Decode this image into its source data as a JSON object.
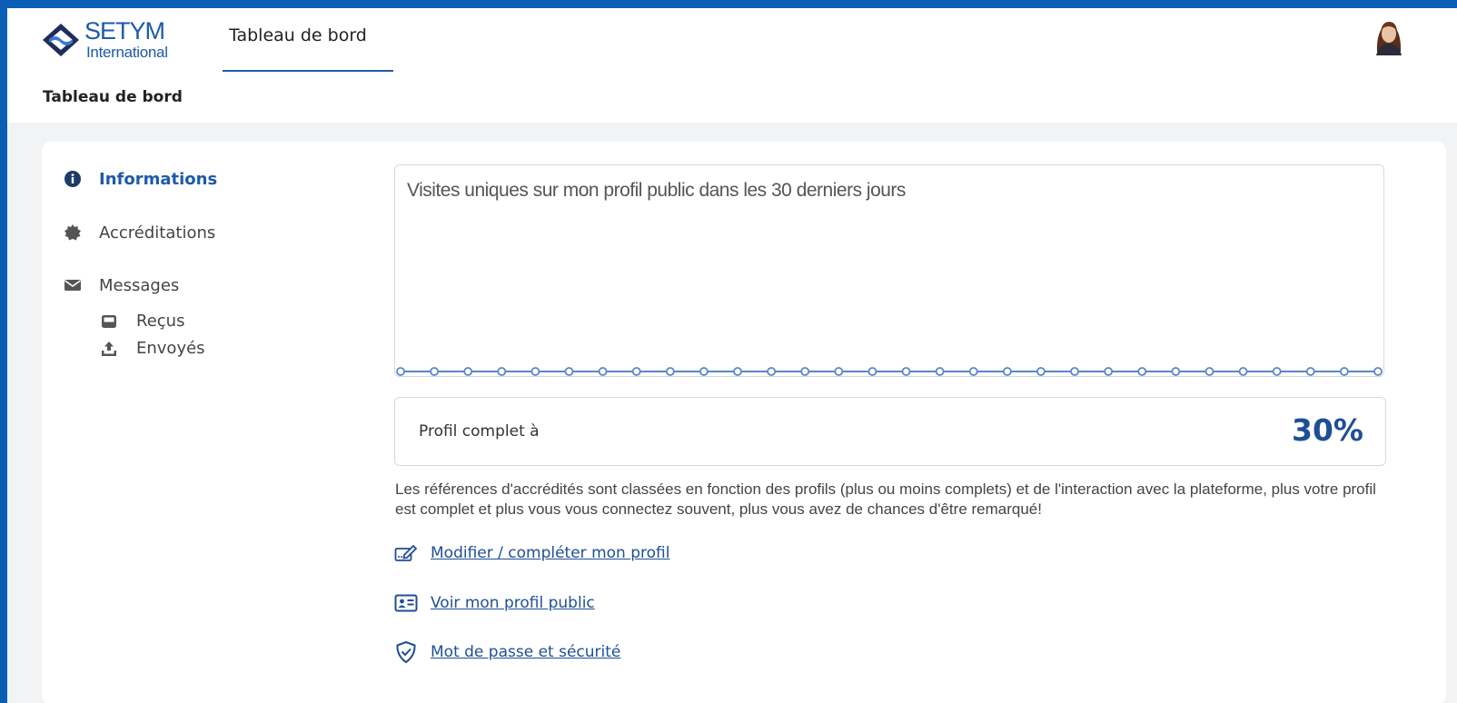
{
  "header": {
    "logo": {
      "brand": "SETYM",
      "sub": "International"
    },
    "tab_label": "Tableau de bord"
  },
  "breadcrumb": "Tableau de bord",
  "sidebar": {
    "items": [
      {
        "label": "Informations",
        "icon": "info-circle-icon",
        "active": true
      },
      {
        "label": "Accréditations",
        "icon": "certificate-badge-icon",
        "active": false
      },
      {
        "label": "Messages",
        "icon": "envelope-icon",
        "active": false
      }
    ],
    "subitems": [
      {
        "label": "Reçus",
        "icon": "inbox-icon"
      },
      {
        "label": "Envoyés",
        "icon": "upload-icon"
      }
    ]
  },
  "chart": {
    "title": "Visites uniques sur mon profil public dans les 30 derniers jours"
  },
  "chart_data": {
    "type": "line",
    "title": "Visites uniques sur mon profil public dans les 30 derniers jours",
    "x_count": 30,
    "series": [
      {
        "values": [
          0,
          0,
          0,
          0,
          0,
          0,
          0,
          0,
          0,
          0,
          0,
          0,
          0,
          0,
          0,
          0,
          0,
          0,
          0,
          0,
          0,
          0,
          0,
          0,
          0,
          0,
          0,
          0,
          0,
          0
        ]
      }
    ],
    "color": "#5b86c7"
  },
  "profile": {
    "label": "Profil complet à",
    "value": "30%",
    "fraction": 0.3
  },
  "note": "Les références d'accrédités sont classées en fonction des profils (plus ou moins complets) et de l'interaction avec la plateforme, plus votre profil est complet et plus vous vous connectez souvent, plus vous avez de chances d'être remarqué!",
  "links": [
    {
      "label": "Modifier / compléter mon profil",
      "icon": "edit-profile-icon"
    },
    {
      "label": "Voir mon profil public",
      "icon": "id-card-icon"
    },
    {
      "label": "Mot de passe et sécurité",
      "icon": "shield-check-icon"
    }
  ],
  "colors": {
    "accent": "#1e5aa8",
    "frame": "#0a5fb4",
    "background": "#f1f3f5"
  }
}
